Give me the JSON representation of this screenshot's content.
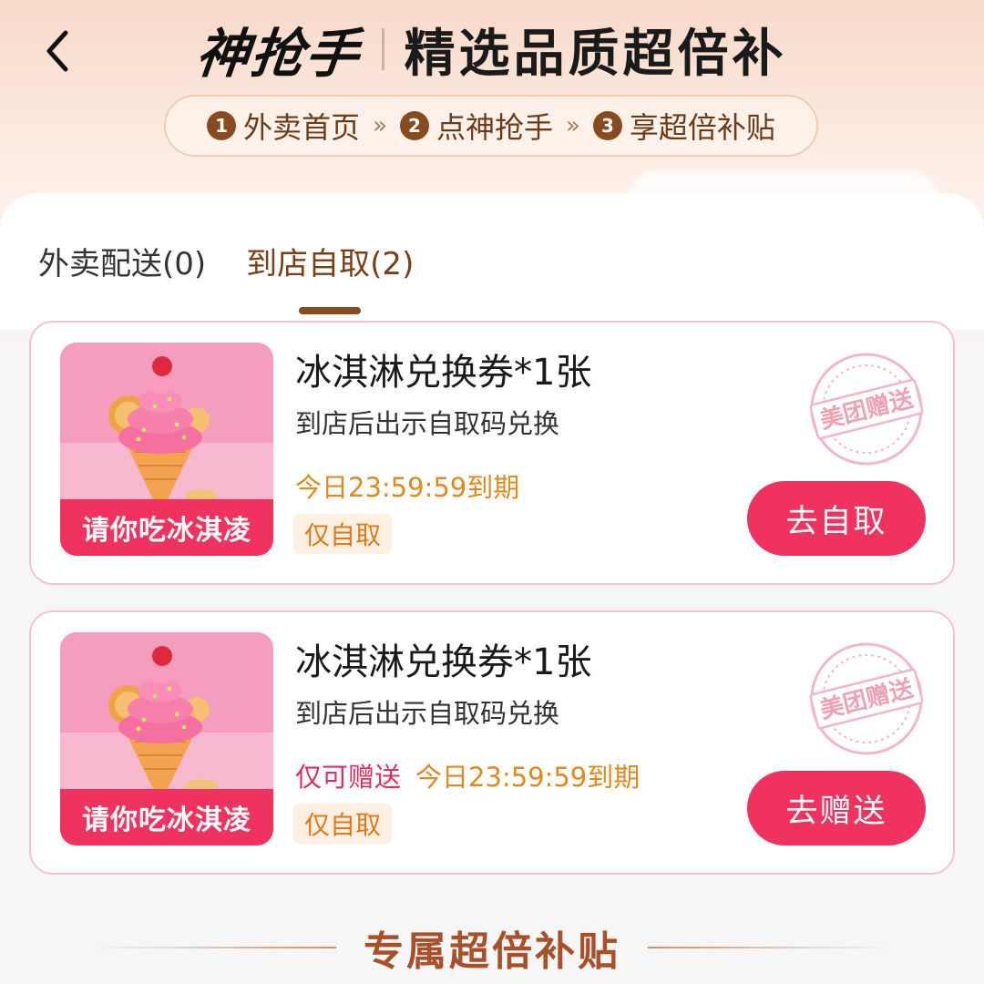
{
  "header": {
    "back_icon": "chevron-left-icon",
    "brand": "神抢手",
    "subtitle": "精选品质超倍补"
  },
  "steps": [
    {
      "num": "1",
      "label": "外卖首页"
    },
    {
      "num": "2",
      "label": "点神抢手"
    },
    {
      "num": "3",
      "label": "享超倍补贴"
    }
  ],
  "step_arrow": "»",
  "tabs": [
    {
      "label": "外卖配送(0)",
      "active": false
    },
    {
      "label": "到店自取(2)",
      "active": true
    }
  ],
  "vouchers": [
    {
      "image_caption": "请你吃冰淇凌",
      "title": "冰淇淋兑换券*1张",
      "description": "到店后出示自取码兑换",
      "gift_only": "",
      "expiry": "今日23:59:59到期",
      "tag": "仅自取",
      "stamp": "美团赠送",
      "action": "去自取"
    },
    {
      "image_caption": "请你吃冰淇凌",
      "title": "冰淇淋兑换券*1张",
      "description": "到店后出示自取码兑换",
      "gift_only": "仅可赠送",
      "expiry": "今日23:59:59到期",
      "tag": "仅自取",
      "stamp": "美团赠送",
      "action": "去赠送"
    }
  ],
  "section_title": "专属超倍补贴",
  "colors": {
    "accent": "#f0325f",
    "brand_brown": "#8a4a1f",
    "expiry_orange": "#e08a1e",
    "gift_pink": "#d8305f",
    "section_title": "#a8502a"
  }
}
